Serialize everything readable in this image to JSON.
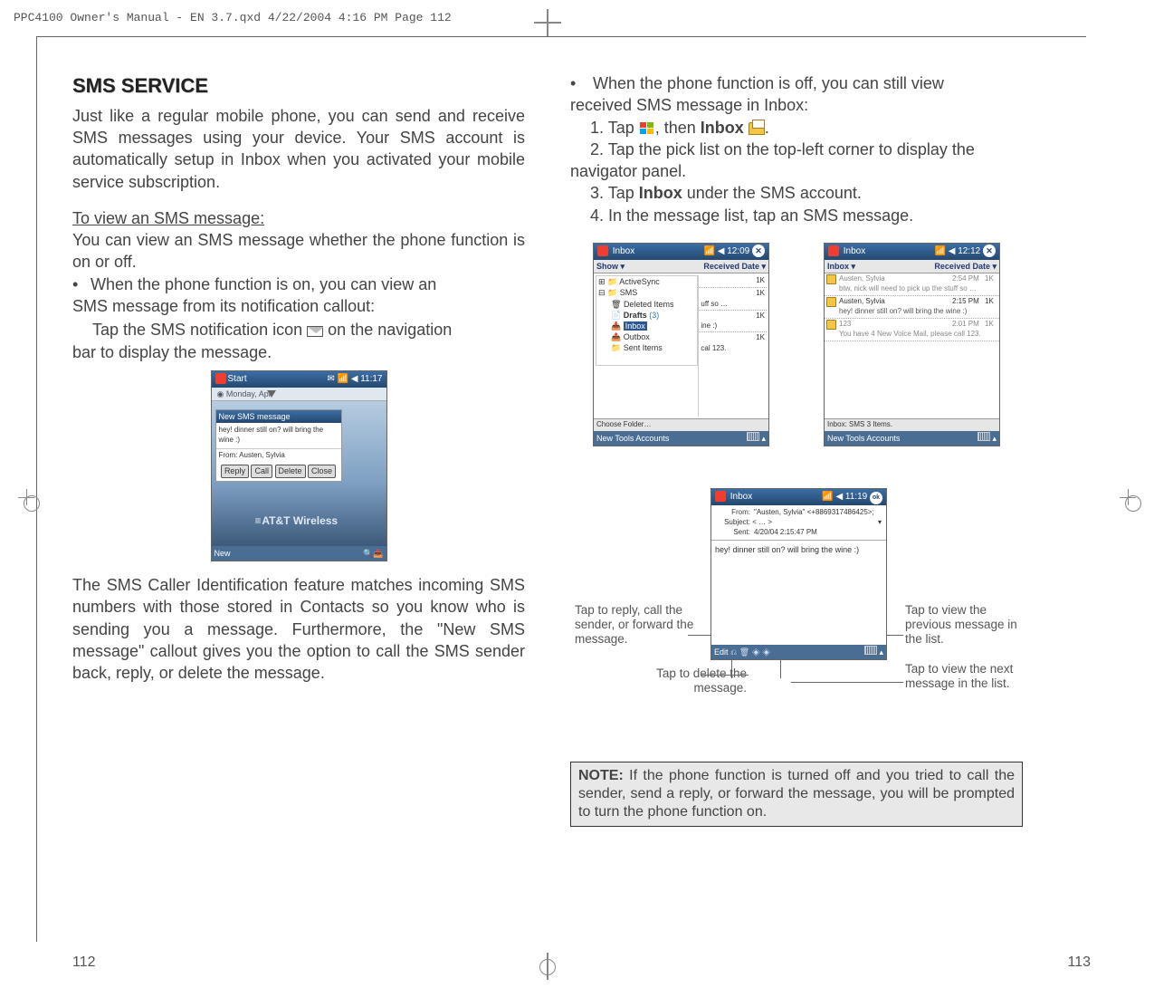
{
  "header_line": "PPC4100 Owner's Manual - EN 3.7.qxd  4/22/2004  4:16 PM  Page 112",
  "left": {
    "title": "SMS SERVICE",
    "intro": "Just like a regular mobile phone, you can send and receive SMS messages using your device. Your SMS account is automatically setup in Inbox when you activated your mobile service subscription.",
    "view_heading": "To view an SMS message:",
    "view_p1": "You can view an SMS message whether the phone function is on or off.",
    "bullet1a": "When the phone function is on, you can view an",
    "bullet1b": "SMS message from its notification callout:",
    "tap_line_a": "Tap the SMS notification icon",
    "tap_line_b": "on the navigation",
    "tap_line_c": "bar to display the message.",
    "caller_p": "The SMS Caller Identification feature matches incoming SMS numbers with those stored in Contacts so you know who is sending you a message. Furthermore, the \"New SMS message\" callout gives you the option to call the SMS sender back, reply, or delete the message.",
    "page_num": "112"
  },
  "right": {
    "bullet_off_a": "When the phone function is off, you can still view",
    "bullet_off_b": "received SMS message in Inbox:",
    "step1_a": "1. Tap",
    "step1_b": ", then",
    "step1_inbox": "Inbox",
    "step1_c": ".",
    "step2": "2. Tap the pick list on the top-left corner to display the navigator panel.",
    "step2_indent_prefix": "",
    "step3_a": "3. Tap",
    "step3_inbox": "Inbox",
    "step3_b": "under the SMS account.",
    "step4": "4. In the message list, tap an SMS message.",
    "annot_reply": "Tap to reply, call the sender, or forward the message.",
    "annot_delete": "Tap to delete the message.",
    "annot_prev": "Tap to view the previous message in the list.",
    "annot_next": "Tap to view the next message in the list.",
    "note_label": "NOTE:",
    "note_body": " If the phone function is turned off and you tried to call the sender, send a reply, or forward the message, you will be prompted to turn the phone function on.",
    "page_num": "113"
  },
  "ss1": {
    "title_left": "Start",
    "title_right": "11:17",
    "under_date": "Monday, Apr",
    "popup_title": "New SMS message",
    "popup_body": "hey! dinner still on? will bring the wine :)",
    "popup_from": "From: Austen, Sylvia",
    "btn_reply": "Reply",
    "btn_call": "Call",
    "btn_delete": "Delete",
    "btn_close": "Close",
    "logo": "AT&T Wireless",
    "foot_new": "New"
  },
  "ss2": {
    "title": "Inbox",
    "time": "12:09",
    "show": "Show",
    "received": "Received Date",
    "tree_as": "ActiveSync",
    "tree_sms": "SMS",
    "tree_deleted": "Deleted Items",
    "tree_drafts": "Drafts",
    "tree_drafts_n": "(3)",
    "tree_inbox": "Inbox",
    "tree_outbox": "Outbox",
    "tree_sent": "Sent Items",
    "as_size": "1K",
    "r_uff": "uff so …",
    "r_1k": "1K",
    "r_ine": "ine :)",
    "r_cal": "cal 123.",
    "status": "Choose Folder…",
    "foot": "New  Tools  Accounts"
  },
  "ss3": {
    "title": "Inbox",
    "time": "12:12",
    "left_label": "Inbox",
    "received": "Received Date",
    "m1_name": "Austen, Sylvia",
    "m1_time": "2:54 PM",
    "m1_size": "1K",
    "m1_sub": "btw, nick will need to pick up the stuff so …",
    "m2_name": "Austen, Sylvia",
    "m2_time": "2:15 PM",
    "m2_size": "1K",
    "m2_sub": "hey! dinner still on? will bring the wine :)",
    "m3_name": "123",
    "m3_time": "2:01 PM",
    "m3_size": "1K",
    "m3_sub": "You have 4 New Voice Mail, please call 123.",
    "status": "Inbox: SMS  3 Items.",
    "foot": "New  Tools  Accounts"
  },
  "ss4": {
    "title": "Inbox",
    "time": "11:19",
    "from_label": "From:",
    "from_val": "\"Austen, Sylvia\" <+8869317486425>;",
    "subj_label": "Subject:",
    "subj_val": "< … >",
    "sent_label": "Sent:",
    "sent_val": "4/20/04 2:15:47 PM",
    "body": "hey! dinner still on? will bring the wine :)",
    "foot_edit": "Edit"
  }
}
